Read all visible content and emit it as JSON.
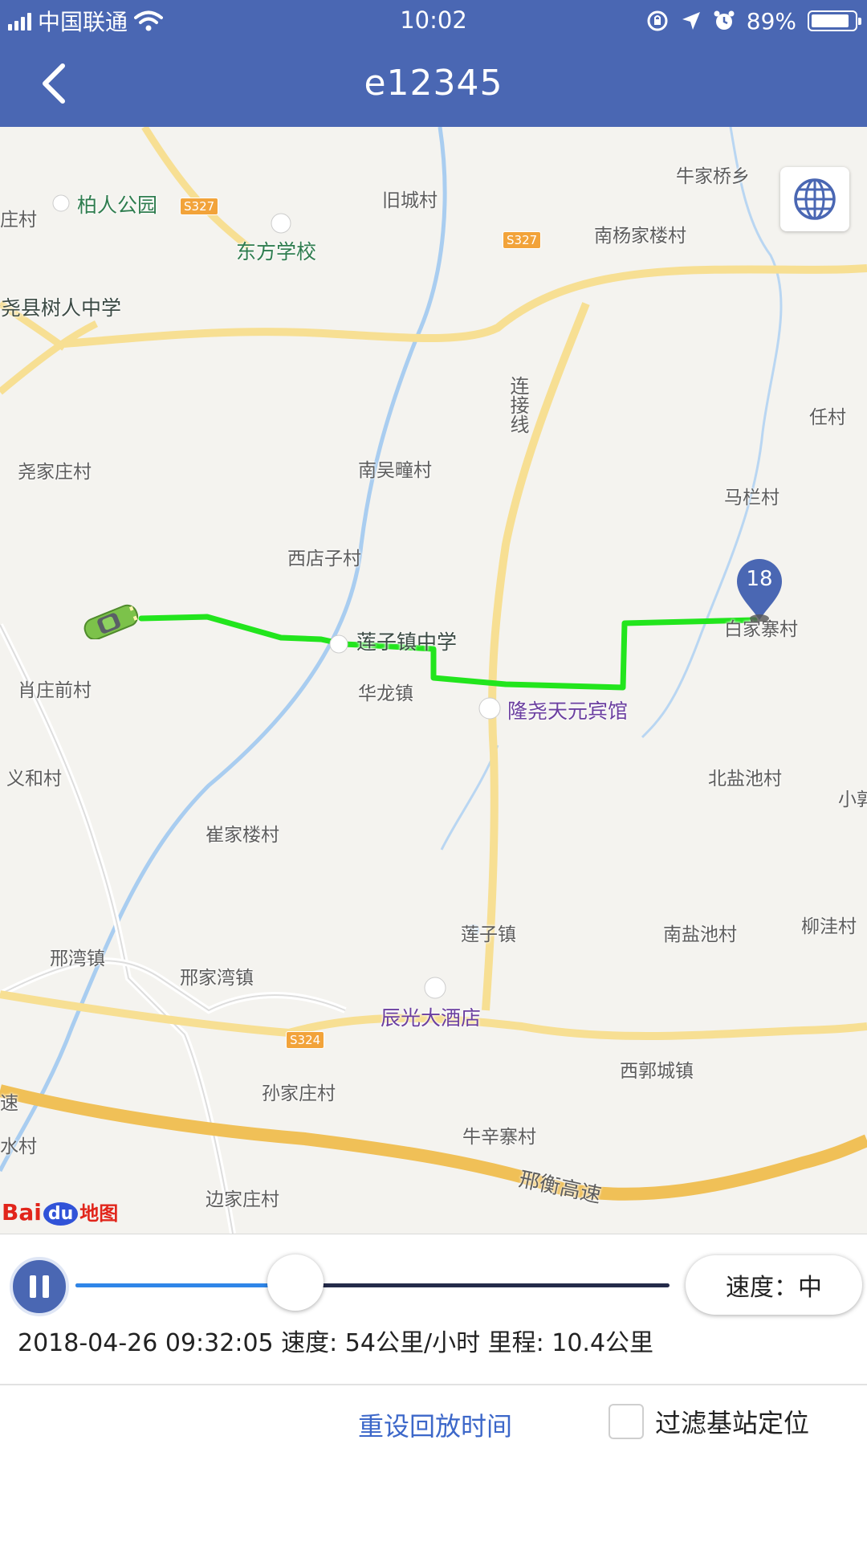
{
  "status_bar": {
    "carrier": "中国联通",
    "time": "10:02",
    "battery": "89%",
    "battery_level": 0.89,
    "icons": [
      "signal-icon",
      "wifi-icon",
      "orientation-lock-icon",
      "location-icon",
      "alarm-icon",
      "battery-icon"
    ]
  },
  "nav": {
    "title": "e12345",
    "back_icon": "chevron-left-icon"
  },
  "map": {
    "labels": {
      "niujiaqiao": "牛家桥乡",
      "bairen_park": "柏人公园",
      "jiucheng": "旧城村",
      "dongfang_school": "东方学校",
      "nanyangjialou": "南杨家楼村",
      "shuren_school": "隆尧县树人中学",
      "lianjiexian": "连接线",
      "renchun": "任村",
      "yaojiazhuang": "尧家庄村",
      "nanwutuan": "南吴疃村",
      "malan": "马栏村",
      "xidianzi": "西店子村",
      "baijiazhai": "白家寨村",
      "lianzi_school": "莲子镇中学",
      "xiaozhuangqian": "肖庄前村",
      "hualong": "华龙镇",
      "tianyuan_hotel": "隆尧天元宾馆",
      "yihe": "义和村",
      "beiyanchi": "北盐池村",
      "cuijialou": "崔家楼村",
      "lianzi_town": "莲子镇",
      "nanyanchi": "南盐池村",
      "liuwa": "柳洼村",
      "xingwan": "邢湾镇",
      "xingjiawan": "邢家湾镇",
      "chenguang_hotel": "辰光大酒店",
      "xiguocheng": "西郭城镇",
      "sunjiazhuang": "孙家庄村",
      "niuxinzhai": "牛辛寨村",
      "xingheng": "邢衡高速",
      "bianjiazhuang": "边家庄村",
      "edge_zhuang": "庄村",
      "edge_su": "速",
      "edge_shui": "水村",
      "edge_xiaoguo": "小郭"
    },
    "shields": {
      "s327a": "S327",
      "s327b": "S327",
      "s324": "S324"
    },
    "marker_number": "18",
    "globe_icon": "globe-icon",
    "car_icon": "car-icon",
    "baidu": {
      "b": "Bai",
      "du": "du",
      "ditu": "地图"
    },
    "track_color": "#22e51d"
  },
  "controls": {
    "play_icon": "pause-icon",
    "progress": 0.37,
    "speed_button": "速度：中",
    "info": "2018-04-26 09:32:05 速度: 54公里/小时 里程: 10.4公里",
    "reset_link": "重设回放时间",
    "filter_label": "过滤基站定位",
    "filter_checked": false
  },
  "colors": {
    "nav_bar": "#4a67b3",
    "accent_blue": "#3c67c9",
    "slider_fill": "#2f86e8",
    "slider_track": "#242b4a",
    "marker": "#4a67b3"
  }
}
